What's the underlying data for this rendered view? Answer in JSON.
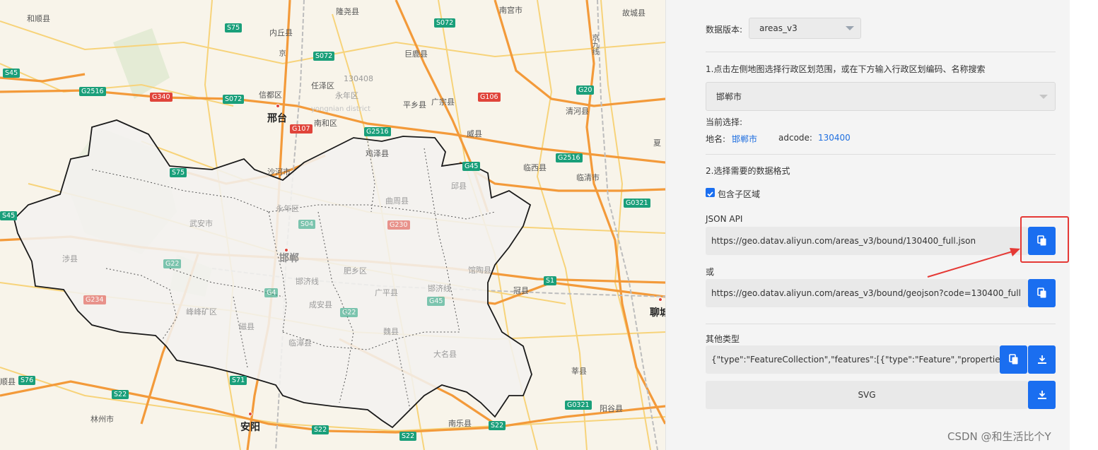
{
  "map": {
    "cities": {
      "xingtai": "邢台",
      "handan": "邯郸",
      "anyang": "安阳",
      "liaocheng": "聊城"
    },
    "labels": {
      "heshun": "和顺县",
      "longyao": "隆尧县",
      "nangong": "南宫市",
      "gucheng": "故城县",
      "neiqiu": "内丘县",
      "jinglu": "京",
      "julu": "巨鹿县",
      "jing_v": "京九线",
      "xindu": "信都区",
      "renze": "任泽区",
      "pingxiang": "平乡县",
      "guangzong": "广宗县",
      "qinghe": "清河县",
      "nanhe": "南和区",
      "weixian": "威县",
      "shahe": "沙河市",
      "jize": "鸡泽县",
      "linxi": "临西县",
      "linqing": "临清市",
      "qiuxian": "邱县",
      "quzhou": "曲周县",
      "yongnian": "永年区",
      "wuan": "武安市",
      "shexian": "涉县",
      "feixiang": "肥乡区",
      "guantao": "馆陶县",
      "guanxian": "冠县",
      "guangping": "广平县",
      "fengfeng": "峰峰矿区",
      "chengan": "成安县",
      "cixian": "磁县",
      "weixian2": "魏县",
      "linzhang": "临漳县",
      "daming": "大名县",
      "shenxian": "莘县",
      "yanggu": "阳谷县",
      "linzhou": "林州市",
      "nanle": "南乐县",
      "shun": "顺县",
      "xia": "夏",
      "hanxing": "邯济线",
      "hanji": "邯济线",
      "num130408": "130408",
      "yongnian2": "永年区",
      "district_en": "yongnian district"
    },
    "shields": {
      "s75": "S75",
      "s072a": "S072",
      "s072b": "S072",
      "s072c": "S072",
      "s45": "S45",
      "g2516a": "G2516",
      "g340": "G340",
      "g106": "G106",
      "g20": "G20",
      "g107": "G107",
      "g2516b": "G2516",
      "g2516c": "G2516",
      "s75b": "S75",
      "g45a": "G45",
      "g0321a": "G0321",
      "s04": "S04",
      "g230": "G230",
      "g22a": "G22",
      "g4": "G4",
      "g22b": "G22",
      "g45b": "G45",
      "s1": "S1",
      "g234": "G234",
      "s76": "S76",
      "s71": "S71",
      "s22a": "S22",
      "s22b": "S22",
      "s22c": "S22",
      "g0321b": "G0321",
      "s22d": "S22",
      "s45b": "S45"
    }
  },
  "panel": {
    "version_label": "数据版本:",
    "version_value": "areas_v3",
    "step1": "1.点击左侧地图选择行政区划范围，或在下方输入行政区划编码、名称搜索",
    "region_value": "邯郸市",
    "current_label": "当前选择:",
    "name_label": "地名:",
    "name_value": "邯郸市",
    "adcode_label": "adcode:",
    "adcode_value": "130400",
    "step2": "2.选择需要的数据格式",
    "include_sub": "包含子区域",
    "json_api_label": "JSON API",
    "json_api_url": "https://geo.datav.aliyun.com/areas_v3/bound/130400_full.json",
    "or_label": "或",
    "geojson_url": "https://geo.datav.aliyun.com/areas_v3/bound/geojson?code=130400_full",
    "other_label": "其他类型",
    "other_value": "{\"type\":\"FeatureCollection\",\"features\":[{\"type\":\"Feature\",\"properties\":{\"a",
    "svg_label": "SVG"
  },
  "watermark": "CSDN @和生活比个Y",
  "colors": {
    "accent": "#1a6ef0",
    "highlight": "#e53935",
    "road_orange": "#f39a3a",
    "road_yellow": "#f7d37a"
  }
}
